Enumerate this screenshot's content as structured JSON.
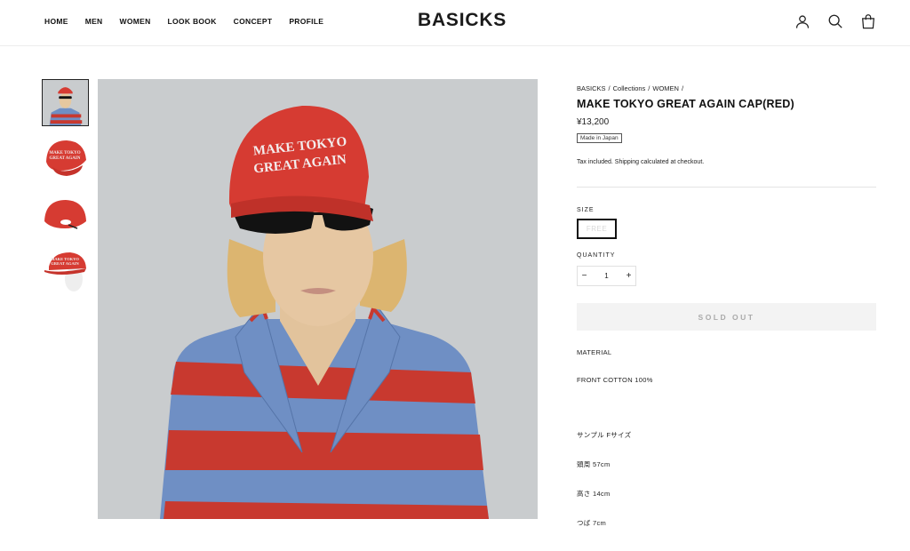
{
  "header": {
    "nav": [
      "HOME",
      "MEN",
      "WOMEN",
      "LOOK BOOK",
      "CONCEPT",
      "PROFILE"
    ],
    "logo": "BASICKS",
    "icons": [
      "account-icon",
      "search-icon",
      "cart-icon"
    ]
  },
  "gallery": {
    "thumbnails": [
      "model-wearing-cap",
      "cap-front",
      "cap-back",
      "cap-on-mannequin"
    ],
    "active_index": 0,
    "main_image": "model-wearing-cap-and-striped-polo",
    "cap_text": "MAKE TOKYO GREAT AGAIN"
  },
  "product": {
    "breadcrumb": [
      "BASICKS",
      "/",
      "Collections",
      "/",
      "WOMEN",
      "/"
    ],
    "title": "MAKE TOKYO GREAT AGAIN CAP(RED)",
    "price": "¥13,200",
    "badge": "Made in Japan",
    "tax_note": "Tax included. Shipping calculated at checkout.",
    "size_label": "SIZE",
    "size_option": "FREE",
    "quantity_label": "QUANTITY",
    "quantity_minus": "−",
    "quantity_value": "1",
    "quantity_plus": "+",
    "button_label": "SOLD OUT",
    "description": {
      "material_heading": "MATERIAL",
      "material_value": "FRONT COTTON 100%",
      "sample_size": "サンプル Fサイズ",
      "head_circumference": "頭周 57cm",
      "height": "高さ 14cm",
      "brim": "つば 7cm"
    }
  },
  "colors": {
    "cap_red": "#d63b32",
    "stripe_red": "#c8392f",
    "stripe_blue": "#6f8fc4",
    "background_gray": "#c9ccce",
    "soldout_bg": "#f3f3f3"
  }
}
